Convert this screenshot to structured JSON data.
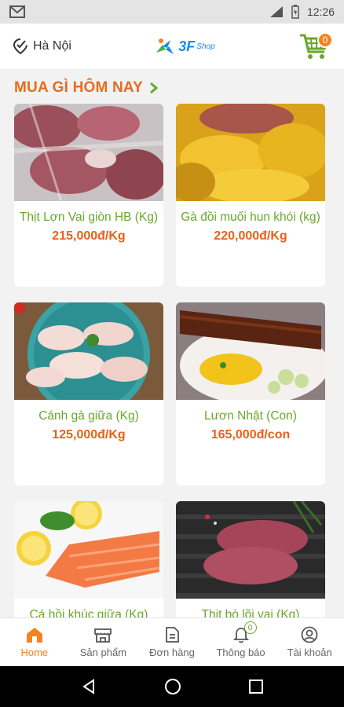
{
  "status_bar": {
    "time": "12:26",
    "notification_icon": "gmail-icon"
  },
  "header": {
    "location": "Hà Nội",
    "logo_text": "3F",
    "logo_sub": "Shop",
    "cart_count": "0"
  },
  "section": {
    "title": "MUA GÌ HÔM NAY"
  },
  "products": [
    {
      "name": "Thịt Lợn Vai giòn HB (Kg)",
      "price": "215,000đ/Kg"
    },
    {
      "name": "Gà đồi muối hun khói (kg)",
      "price": "220,000đ/Kg"
    },
    {
      "name": "Cánh gà giữa (Kg)",
      "price": "125,000đ/Kg"
    },
    {
      "name": "Lươn Nhật (Con)",
      "price": "165,000đ/con"
    },
    {
      "name": "Cá hồi khúc giữa (Kg)",
      "price": ""
    },
    {
      "name": "Thịt bò lõi vai (Kg)",
      "price": ""
    }
  ],
  "tabs": [
    {
      "label": "Home",
      "icon": "home-icon",
      "active": true
    },
    {
      "label": "Sản phẩm",
      "icon": "store-icon"
    },
    {
      "label": "Đơn hàng",
      "icon": "document-icon"
    },
    {
      "label": "Thông báo",
      "icon": "bell-icon",
      "badge": "0"
    },
    {
      "label": "Tài khoản",
      "icon": "account-icon"
    }
  ],
  "colors": {
    "accent": "#f5821f",
    "price": "#e8611a",
    "name": "#6aa82c",
    "title": "#e86b1c"
  }
}
